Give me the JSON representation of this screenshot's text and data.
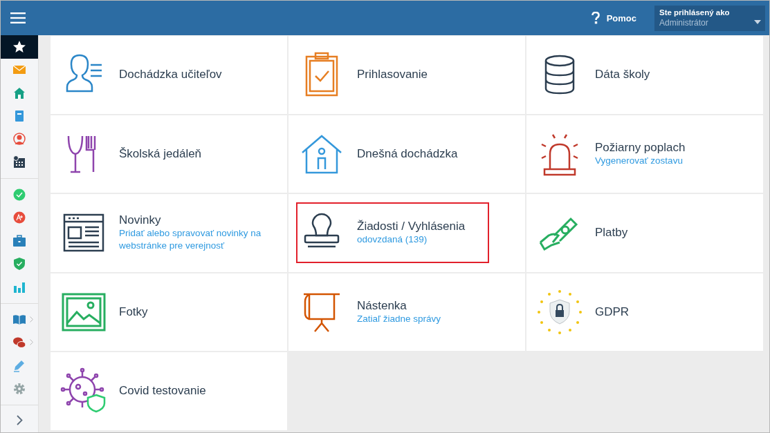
{
  "header": {
    "help_label": "Pomoc",
    "user_caption": "Ste prihlásený ako",
    "user_role": "Administrátor"
  },
  "sidebar": {
    "groups": [
      [
        {
          "color": "#ffffff",
          "selected": true,
          "has_submenu": false
        },
        {
          "color": "#f39c12",
          "selected": false,
          "has_submenu": false
        },
        {
          "color": "#16a085",
          "selected": false,
          "has_submenu": false
        },
        {
          "color": "#3498db",
          "selected": false,
          "has_submenu": false
        },
        {
          "color": "#e74c3c",
          "selected": false,
          "has_submenu": false
        },
        {
          "color": "#2c3e50",
          "selected": false,
          "has_submenu": false
        }
      ],
      [
        {
          "color": "#2ecc71",
          "selected": false,
          "has_submenu": false
        },
        {
          "color": "#e74c3c",
          "selected": false,
          "has_submenu": false
        },
        {
          "color": "#2980b9",
          "selected": false,
          "has_submenu": false
        },
        {
          "color": "#27ae60",
          "selected": false,
          "has_submenu": false
        },
        {
          "color": "#1fb5d0",
          "selected": false,
          "has_submenu": false
        }
      ],
      [
        {
          "color": "#2980b9",
          "selected": false,
          "has_submenu": true
        },
        {
          "color": "#c0392b",
          "selected": false,
          "has_submenu": true
        },
        {
          "color": "#5dade2",
          "selected": false,
          "has_submenu": false
        },
        {
          "color": "#95a5a6",
          "selected": false,
          "has_submenu": false
        }
      ]
    ]
  },
  "tiles": [
    {
      "title": "Dochádzka učiteľov",
      "highlighted": false
    },
    {
      "title": "Prihlasovanie",
      "highlighted": false
    },
    {
      "title": "Dáta školy",
      "highlighted": false
    },
    {
      "title": "Školská jedáleň",
      "highlighted": false
    },
    {
      "title": "Dnešná dochádzka",
      "highlighted": false
    },
    {
      "title": "Požiarny poplach",
      "subtitle": "Vygenerovať zostavu",
      "highlighted": false
    },
    {
      "title": "Novinky",
      "subtitle": "Pridať alebo spravovať novinky na webstránke pre verejnosť",
      "highlighted": false
    },
    {
      "title": "Žiadosti / Vyhlásenia",
      "subtitle": "odovzdaná (139)",
      "highlighted": true
    },
    {
      "title": "Platby",
      "highlighted": false
    },
    {
      "title": "Fotky",
      "highlighted": false
    },
    {
      "title": "Nástenka",
      "subtitle": "Zatiaľ žiadne správy",
      "highlighted": false
    },
    {
      "title": "GDPR",
      "highlighted": false
    },
    {
      "title": "Covid testovanie",
      "highlighted": false
    }
  ]
}
